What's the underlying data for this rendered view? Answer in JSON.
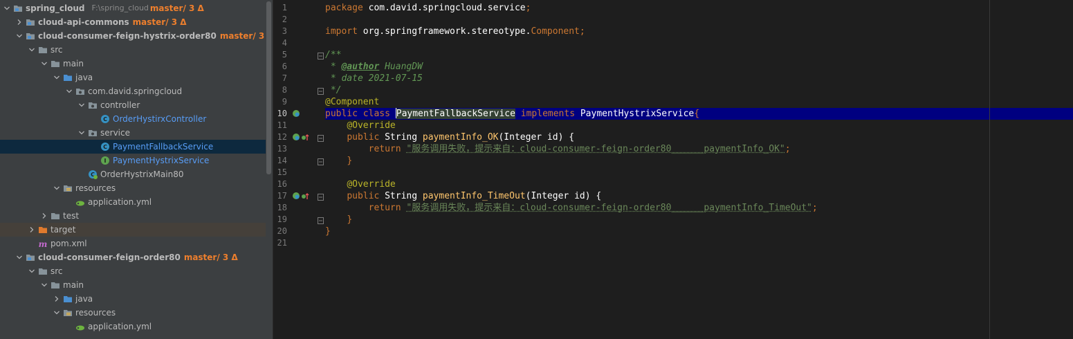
{
  "project_tree": {
    "rows": [
      {
        "label": "spring_cloud",
        "path": "F:\\spring_cloud",
        "git": "master/ 3 Δ",
        "bold": true,
        "icon": "module-folder-icon",
        "arrow": "down",
        "indent": 0
      },
      {
        "label": "cloud-api-commons",
        "git": "master/ 3 Δ",
        "bold": true,
        "icon": "module-folder-icon",
        "arrow": "right",
        "indent": 1
      },
      {
        "label": "cloud-consumer-feign-hystrix-order80",
        "git": "master/ 3 Δ",
        "bold": true,
        "icon": "module-folder-icon",
        "arrow": "down",
        "indent": 1
      },
      {
        "label": "src",
        "icon": "folder-icon",
        "arrow": "down",
        "indent": 2
      },
      {
        "label": "main",
        "icon": "folder-icon",
        "arrow": "down",
        "indent": 3
      },
      {
        "label": "java",
        "icon": "source-folder-icon",
        "arrow": "down",
        "indent": 4
      },
      {
        "label": "com.david.springcloud",
        "icon": "package-icon",
        "arrow": "down",
        "indent": 5
      },
      {
        "label": "controller",
        "icon": "package-icon",
        "arrow": "down",
        "indent": 6
      },
      {
        "label": "OrderHystirxController",
        "icon": "class-icon",
        "arrow": "none",
        "indent": 7,
        "cls": true
      },
      {
        "label": "service",
        "icon": "package-icon",
        "arrow": "down",
        "indent": 6
      },
      {
        "label": "PaymentFallbackService",
        "icon": "class-icon",
        "arrow": "none",
        "indent": 7,
        "cls": true,
        "selected": true
      },
      {
        "label": "PaymentHystrixService",
        "icon": "interface-icon",
        "arrow": "none",
        "indent": 7,
        "cls": true
      },
      {
        "label": "OrderHystrixMain80",
        "icon": "spring-class-icon",
        "arrow": "none",
        "indent": 6
      },
      {
        "label": "resources",
        "icon": "resources-folder-icon",
        "arrow": "down",
        "indent": 4
      },
      {
        "label": "application.yml",
        "icon": "yml-file-icon",
        "arrow": "none",
        "indent": 5
      },
      {
        "label": "test",
        "icon": "folder-icon",
        "arrow": "right",
        "indent": 3
      },
      {
        "label": "target",
        "icon": "excluded-folder-icon",
        "arrow": "right",
        "indent": 2,
        "target": true
      },
      {
        "label": "pom.xml",
        "icon": "maven-icon",
        "arrow": "none",
        "indent": 2
      },
      {
        "label": "cloud-consumer-feign-order80",
        "git": "master/ 3 Δ",
        "bold": true,
        "icon": "module-folder-icon",
        "arrow": "down",
        "indent": 1
      },
      {
        "label": "src",
        "icon": "folder-icon",
        "arrow": "down",
        "indent": 2
      },
      {
        "label": "main",
        "icon": "folder-icon",
        "arrow": "down",
        "indent": 3
      },
      {
        "label": "java",
        "icon": "source-folder-icon",
        "arrow": "right",
        "indent": 4
      },
      {
        "label": "resources",
        "icon": "resources-folder-icon",
        "arrow": "down",
        "indent": 4
      },
      {
        "label": "application.yml",
        "icon": "yml-file-icon",
        "arrow": "none",
        "indent": 5
      }
    ]
  },
  "editor": {
    "line_numbers": [
      "1",
      "2",
      "3",
      "4",
      "5",
      "6",
      "7",
      "8",
      "9",
      "10",
      "11",
      "12",
      "13",
      "14",
      "15",
      "16",
      "17",
      "18",
      "19",
      "20",
      "21"
    ],
    "current_line": "10",
    "lines": [
      [
        {
          "t": "package ",
          "c": "k"
        },
        {
          "t": "com.david.springcloud.service",
          "c": "pk"
        },
        {
          "t": ";",
          "c": "k"
        }
      ],
      [],
      [
        {
          "t": "import ",
          "c": "k"
        },
        {
          "t": "org.springframework.stereotype.",
          "c": "pk"
        },
        {
          "t": "Component",
          "c": "k"
        },
        {
          "t": ";",
          "c": "k"
        }
      ],
      [],
      [
        {
          "t": "/**",
          "c": "cm"
        }
      ],
      [
        {
          "t": " * ",
          "c": "cm"
        },
        {
          "t": "@author",
          "c": "tag"
        },
        {
          "t": " HuangDW",
          "c": "cm"
        }
      ],
      [
        {
          "t": " * date 2021-07-15",
          "c": "cm"
        }
      ],
      [
        {
          "t": " */",
          "c": "cm"
        }
      ],
      [
        {
          "t": "@Component",
          "c": "ann"
        }
      ],
      [
        {
          "t": "public class ",
          "c": "k"
        },
        {
          "t": "",
          "c": "caret"
        },
        {
          "t": "PaymentFallbackService",
          "c": "cls-hl"
        },
        {
          "t": " implements ",
          "c": "k"
        },
        {
          "t": "PaymentHystrixService",
          "c": "cls-name"
        },
        {
          "t": "{",
          "c": "k"
        }
      ],
      [
        {
          "t": "    "
        },
        {
          "t": "@Override",
          "c": "ann"
        }
      ],
      [
        {
          "t": "    "
        },
        {
          "t": "public ",
          "c": "k"
        },
        {
          "t": "String ",
          "c": "cls-name"
        },
        {
          "t": "paymentInfo_OK",
          "c": "fn"
        },
        {
          "t": "(Integer id) {",
          "c": "cls-name"
        }
      ],
      [
        {
          "t": "        "
        },
        {
          "t": "return ",
          "c": "k"
        },
        {
          "t": "\"服务调用失败，提示来自：cloud-consumer-feign-order80______paymentInfo_OK\"",
          "c": "str"
        },
        {
          "t": ";",
          "c": "k"
        }
      ],
      [
        {
          "t": "    "
        },
        {
          "t": "}",
          "c": "k"
        }
      ],
      [],
      [
        {
          "t": "    "
        },
        {
          "t": "@Override",
          "c": "ann"
        }
      ],
      [
        {
          "t": "    "
        },
        {
          "t": "public ",
          "c": "k"
        },
        {
          "t": "String ",
          "c": "cls-name"
        },
        {
          "t": "paymentInfo_TimeOut",
          "c": "fn"
        },
        {
          "t": "(Integer id) {",
          "c": "cls-name"
        }
      ],
      [
        {
          "t": "        "
        },
        {
          "t": "return ",
          "c": "k"
        },
        {
          "t": "\"服务调用失败，提示来自：cloud-consumer-feign-order80______paymentInfo_TimeOut\"",
          "c": "str"
        },
        {
          "t": ";",
          "c": "k"
        }
      ],
      [
        {
          "t": "    "
        },
        {
          "t": "}",
          "c": "k"
        }
      ],
      [
        {
          "t": "}",
          "c": "k"
        }
      ],
      []
    ],
    "gutter_icons": [
      {
        "line": 10,
        "icon": "implemented-interface-icon"
      },
      {
        "line": 12,
        "icon": "implements-method-icon"
      },
      {
        "line": 17,
        "icon": "implements-method-icon"
      }
    ],
    "fold_markers": [
      5,
      8,
      12,
      14,
      17,
      19
    ]
  },
  "colors": {
    "tree_bg": "#3c3f41",
    "editor_bg": "#1e1e1e",
    "selection": "#0d293e",
    "current_line": "#000080",
    "git_branch": "#ee7f2d",
    "keyword": "#cc7832",
    "string": "#6a8759",
    "annotation": "#bbb529",
    "method": "#ffc66d"
  }
}
